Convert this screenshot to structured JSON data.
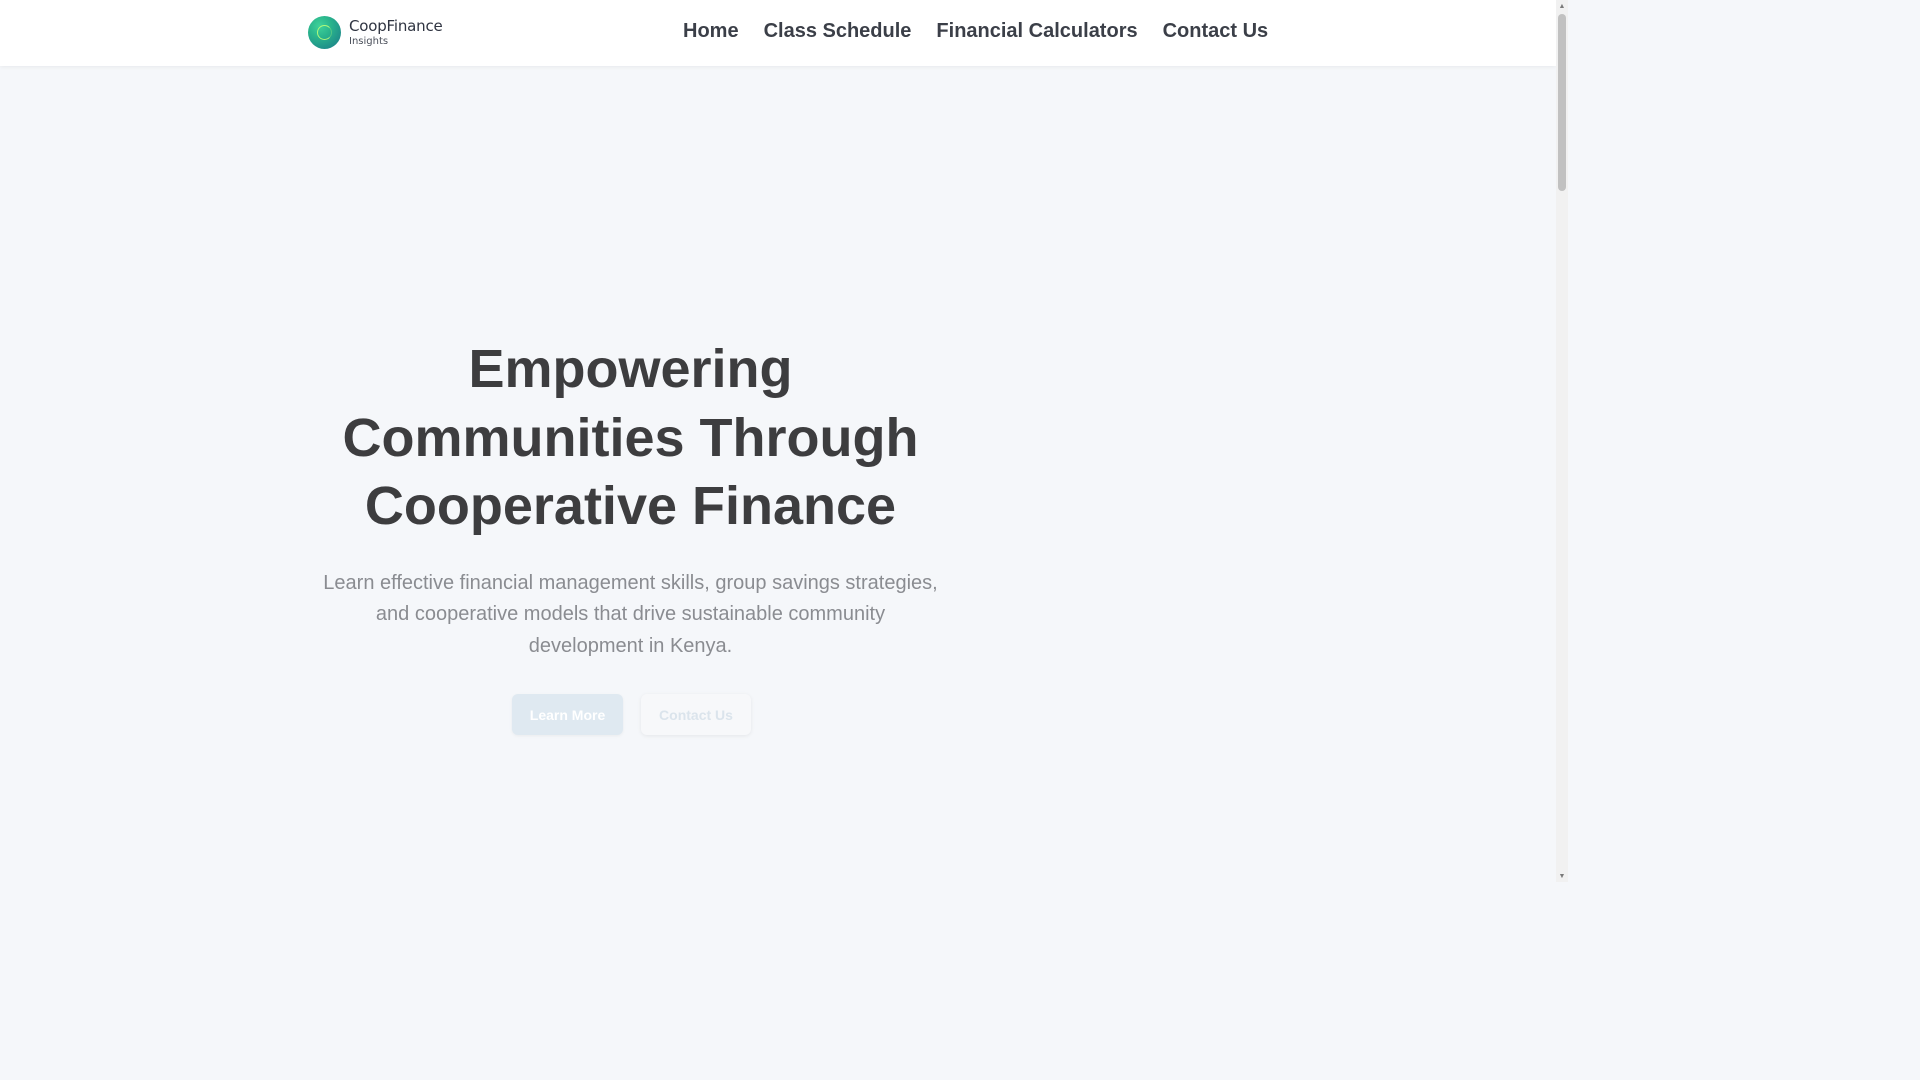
{
  "brand": {
    "name": "CoopFinance",
    "tagline": "Insights",
    "logo_icon": "circular-gradient-logo-icon",
    "colors": {
      "green": "#3fd29a",
      "teal": "#1b7e86"
    }
  },
  "nav": {
    "items": [
      {
        "label": "Home"
      },
      {
        "label": "Class Schedule"
      },
      {
        "label": "Financial Calculators"
      },
      {
        "label": "Contact Us"
      }
    ]
  },
  "hero": {
    "title_lines": [
      "Empowering",
      "Communities Through",
      "Cooperative Finance"
    ],
    "subtitle": "Learn effective financial management skills, group savings strategies, and cooperative models that drive sustainable community development in Kenya.",
    "primary_button": "Learn More",
    "secondary_button": "Contact Us"
  },
  "colors": {
    "page_background": "#f5f7fa",
    "heading": "#3d3d3f",
    "body_text": "#8a8c91",
    "nav_text": "#3b3f48"
  }
}
